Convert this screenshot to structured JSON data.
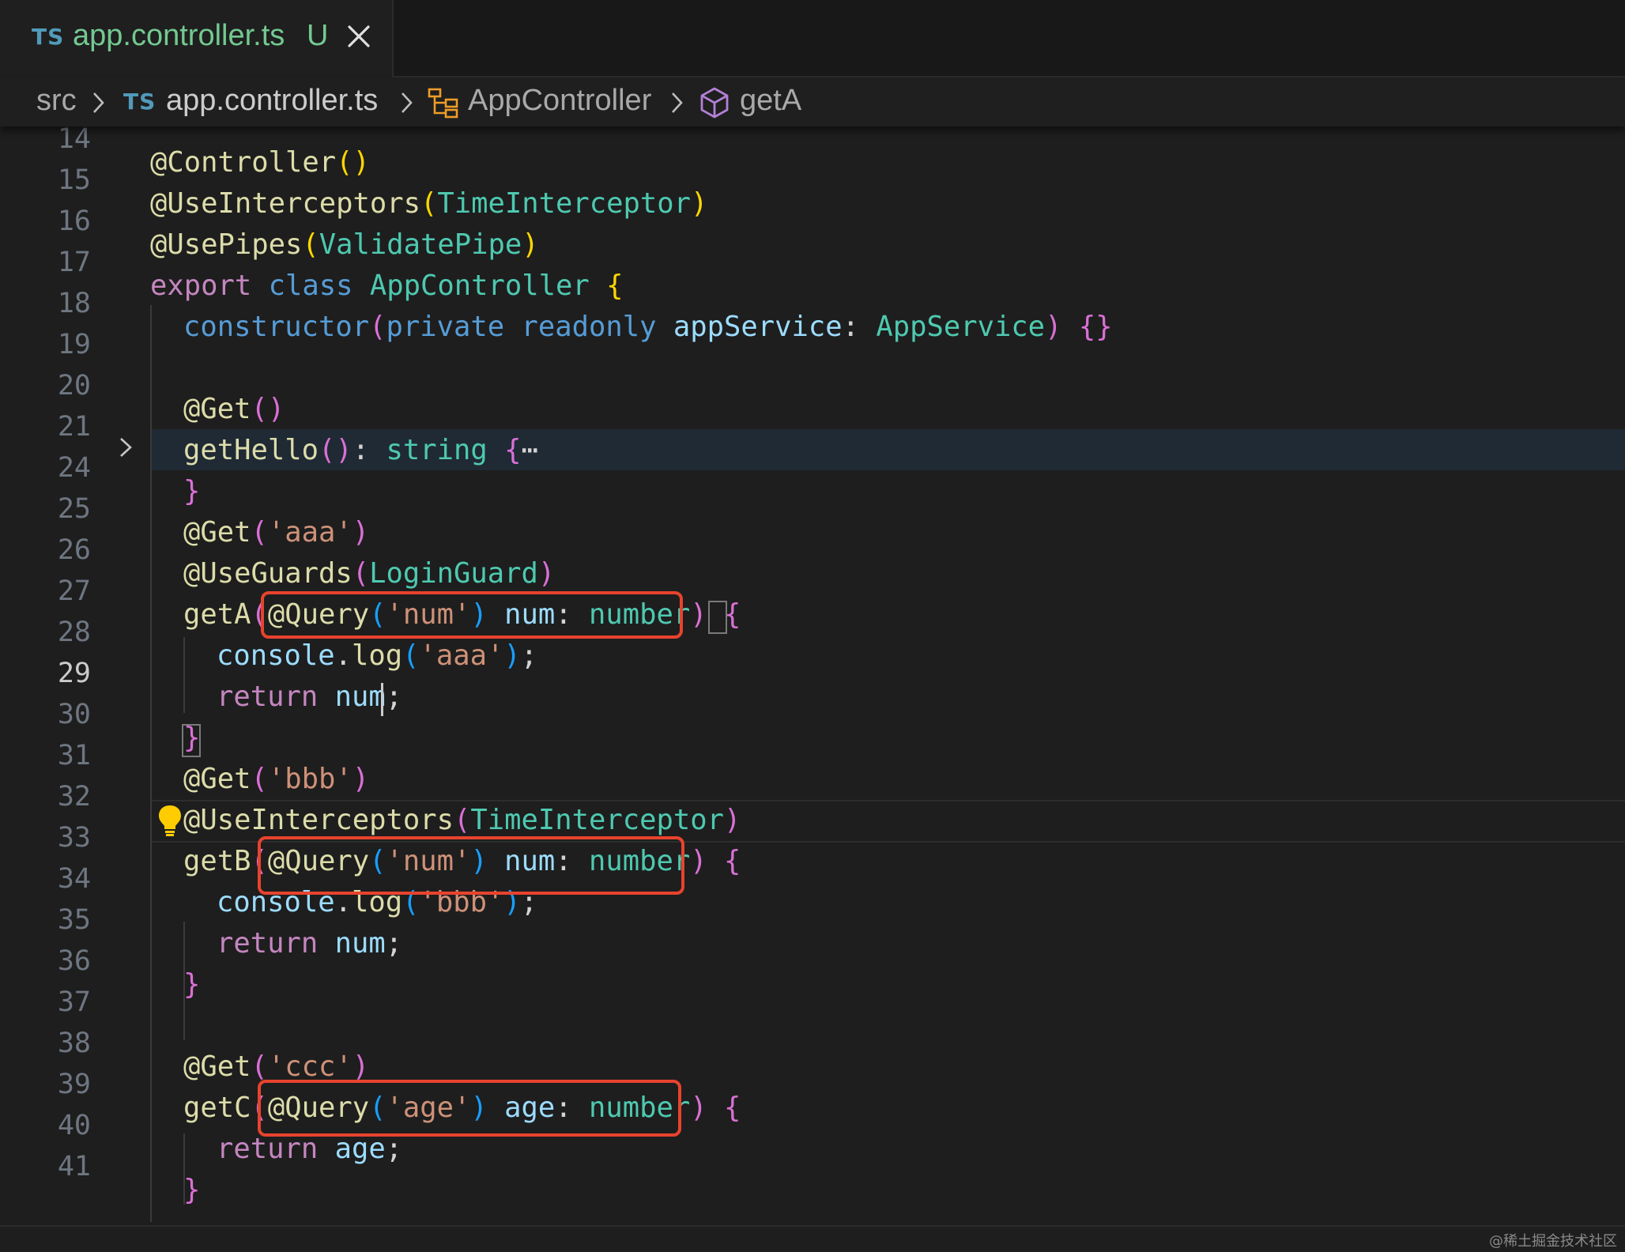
{
  "tab": {
    "lang_badge": "TS",
    "title": "app.controller.ts",
    "status": "U"
  },
  "breadcrumb": {
    "folder": "src",
    "lang_badge": "TS",
    "file": "app.controller.ts",
    "class_name": "AppController",
    "method_name": "getA"
  },
  "editor": {
    "active_line": "29",
    "lines": [
      {
        "num": "14"
      },
      {
        "num": "15"
      },
      {
        "num": "16"
      },
      {
        "num": "17"
      },
      {
        "num": "18"
      },
      {
        "num": "19"
      },
      {
        "num": "20"
      },
      {
        "num": "21"
      },
      {
        "num": "24"
      },
      {
        "num": "25"
      },
      {
        "num": "26"
      },
      {
        "num": "27"
      },
      {
        "num": "28"
      },
      {
        "num": "29"
      },
      {
        "num": "30"
      },
      {
        "num": "31"
      },
      {
        "num": "32"
      },
      {
        "num": "33"
      },
      {
        "num": "34"
      },
      {
        "num": "35"
      },
      {
        "num": "36"
      },
      {
        "num": "37"
      },
      {
        "num": "38"
      },
      {
        "num": "39"
      },
      {
        "num": "40"
      },
      {
        "num": "41"
      }
    ],
    "code": {
      "at": "@",
      "controller": "Controller",
      "use_interceptors": "UseInterceptors",
      "time_interceptor": "TimeInterceptor",
      "use_pipes": "UsePipes",
      "validate_pipe": "ValidatePipe",
      "export_kw": "export",
      "class_kw": "class",
      "app_controller": "AppController",
      "constructor_kw": "constructor",
      "private_kw": "private",
      "readonly_kw": "readonly",
      "app_service_param": "appService",
      "app_service_type": "AppService",
      "get": "Get",
      "get_hello": "getHello",
      "string_type": "string",
      "fold_ellipsis": "⋯",
      "str_aaa": "'aaa'",
      "use_guards": "UseGuards",
      "login_guard": "LoginGuard",
      "get_a": "getA",
      "query": "Query",
      "str_num": "'num'",
      "num": "num",
      "number_type": "number",
      "console": "console",
      "log": "log",
      "return_kw": "return",
      "str_bbb": "'bbb'",
      "get_b": "getB",
      "str_ccc": "'ccc'",
      "get_c": "getC",
      "str_age": "'age'",
      "age": "age"
    }
  },
  "watermark": "@稀土掘金技术社区",
  "colors": {
    "keyword": "#569cd6",
    "control": "#c586c0",
    "type": "#4ec9b0",
    "function": "#dcdcaa",
    "variable": "#9cdcfe",
    "string": "#ce9178",
    "highlight_box": "#e8432e"
  },
  "icons": [
    "close-icon",
    "chevron-right-icon",
    "class-icon",
    "method-cube-icon",
    "lightbulb-icon"
  ]
}
